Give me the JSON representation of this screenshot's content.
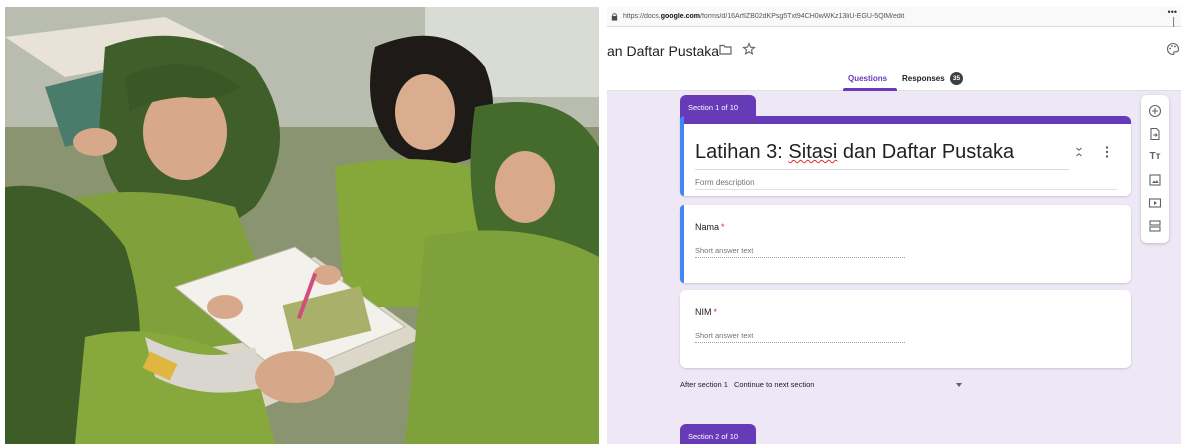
{
  "browser": {
    "url_prefix": "https://docs.",
    "url_domain": "google.com",
    "url_rest": "/forms/d/16ArfIZB02dKPsg5Txt94CH0wWKz13liU-EGU-5QlM/edit",
    "more_label": "••• │"
  },
  "header": {
    "doc_title": "an Daftar Pustaka",
    "tabs": [
      {
        "label": "Questions",
        "active": true
      },
      {
        "label": "Responses"
      }
    ],
    "responses_count": "35"
  },
  "sections": [
    {
      "label": "Section 1 of 10"
    },
    {
      "label": "Section 2 of 10"
    }
  ],
  "form": {
    "title_prefix": "Latihan 3: ",
    "title_misspelled": "Sitasi",
    "title_suffix": " dan Daftar Pustaka",
    "description_placeholder": "Form description"
  },
  "questions": [
    {
      "label": "Nama",
      "required_mark": "*",
      "hint": "Short answer text"
    },
    {
      "label": "NIM",
      "required_mark": "*",
      "hint": "Short answer text"
    }
  ],
  "after_section": {
    "label": "After section 1",
    "value": "Continue to next section"
  },
  "toolbar": {
    "icons": [
      "add-question-icon",
      "import-questions-icon",
      "add-title-icon",
      "add-image-icon",
      "add-video-icon",
      "add-section-icon"
    ],
    "title_glyph": "Tт"
  },
  "colors": {
    "accent": "#673ab7",
    "active_bar": "#4285f4",
    "required": "#d93025",
    "background": "#ede7f6"
  }
}
